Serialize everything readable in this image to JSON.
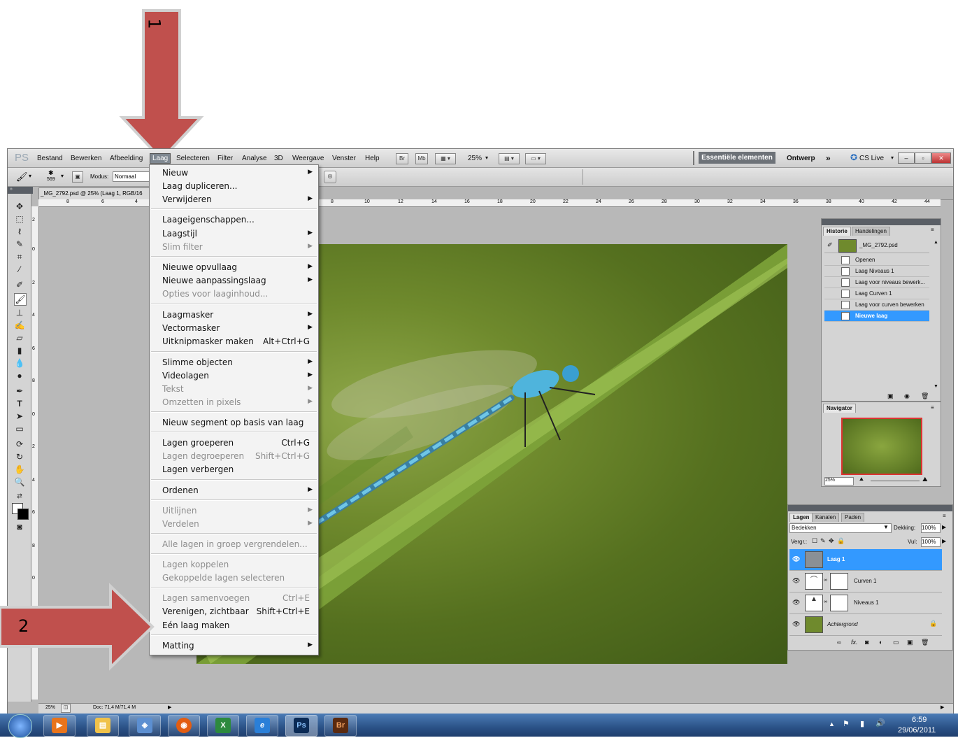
{
  "annotations": {
    "arrow1_label": "1",
    "arrow2_label": "2"
  },
  "colors": {
    "arrow_fill": "#c0504d",
    "arrow_border": "#cccccc",
    "menu_bg": "#f3f3f3",
    "selected_blue": "#3399ff"
  },
  "menubar": {
    "logo": "PS",
    "items": [
      "Bestand",
      "Bewerken",
      "Afbeelding",
      "Laag",
      "Selecteren",
      "Filter",
      "Analyse",
      "3D",
      "Weergave",
      "Venster",
      "Help"
    ],
    "br": "Br",
    "mb": "Mb",
    "zoom": "25%",
    "workspace_active": "Essentiële elementen",
    "workspace_other": "Ontwerp",
    "more": "»",
    "cslive": "CS Live"
  },
  "optionsbar": {
    "brush_size": "569",
    "mode_label": "Modus:",
    "mode_value": "Normaal"
  },
  "document": {
    "tab_title": "_MG_2792.psd @ 25% (Laag 1, RGB/16"
  },
  "ruler_top": [
    "8",
    "6",
    "4",
    "8",
    "10",
    "12",
    "14",
    "16",
    "18",
    "20",
    "22",
    "24",
    "26",
    "28",
    "30",
    "32",
    "34",
    "36",
    "38",
    "40",
    "42",
    "44"
  ],
  "ruler_left": [
    "2",
    "0",
    "2",
    "4",
    "6",
    "8",
    "0",
    "2",
    "4",
    "6",
    "8",
    "0",
    "2",
    "4"
  ],
  "statusbar": {
    "zoom": "25%",
    "doc": "Doc: 71,4 M/71,4 M"
  },
  "laag_menu": {
    "groups": [
      [
        {
          "label": "Nieuw",
          "submenu": true
        },
        {
          "label": "Laag dupliceren..."
        },
        {
          "label": "Verwijderen",
          "submenu": true
        }
      ],
      [
        {
          "label": "Laageigenschappen..."
        },
        {
          "label": "Laagstijl",
          "submenu": true
        },
        {
          "label": "Slim filter",
          "submenu": true,
          "disabled": true
        }
      ],
      [
        {
          "label": "Nieuwe opvullaag",
          "submenu": true
        },
        {
          "label": "Nieuwe aanpassingslaag",
          "submenu": true
        },
        {
          "label": "Opties voor laaginhoud...",
          "disabled": true
        }
      ],
      [
        {
          "label": "Laagmasker",
          "submenu": true
        },
        {
          "label": "Vectormasker",
          "submenu": true
        },
        {
          "label": "Uitknipmasker maken",
          "shortcut": "Alt+Ctrl+G"
        }
      ],
      [
        {
          "label": "Slimme objecten",
          "submenu": true
        },
        {
          "label": "Videolagen",
          "submenu": true
        },
        {
          "label": "Tekst",
          "submenu": true,
          "disabled": true
        },
        {
          "label": "Omzetten in pixels",
          "submenu": true,
          "disabled": true
        }
      ],
      [
        {
          "label": "Nieuw segment op basis van laag"
        }
      ],
      [
        {
          "label": "Lagen groeperen",
          "shortcut": "Ctrl+G"
        },
        {
          "label": "Lagen degroeperen",
          "shortcut": "Shift+Ctrl+G",
          "disabled": true
        },
        {
          "label": "Lagen verbergen"
        }
      ],
      [
        {
          "label": "Ordenen",
          "submenu": true
        }
      ],
      [
        {
          "label": "Uitlijnen",
          "submenu": true,
          "disabled": true
        },
        {
          "label": "Verdelen",
          "submenu": true,
          "disabled": true
        }
      ],
      [
        {
          "label": "Alle lagen in groep vergrendelen...",
          "disabled": true
        }
      ],
      [
        {
          "label": "Lagen koppelen",
          "disabled": true
        },
        {
          "label": "Gekoppelde lagen selecteren",
          "disabled": true
        }
      ],
      [
        {
          "label": "Lagen samenvoegen",
          "shortcut": "Ctrl+E",
          "disabled": true
        },
        {
          "label": "Verenigen, zichtbaar",
          "shortcut": "Shift+Ctrl+E"
        },
        {
          "label": "Eén laag maken"
        }
      ],
      [
        {
          "label": "Matting",
          "submenu": true
        }
      ]
    ]
  },
  "historie": {
    "tabs": [
      "Historie",
      "Handelingen"
    ],
    "snapshot": "_MG_2792.psd",
    "items": [
      "Openen",
      "Laag Niveaus 1",
      "Laag voor niveaus bewerk...",
      "Laag Curven 1",
      "Laag voor curven bewerken",
      "Nieuwe laag"
    ],
    "selected_index": 5
  },
  "navigator": {
    "tab": "Navigator",
    "zoom": "25%"
  },
  "lagen": {
    "tabs": [
      "Lagen",
      "Kanalen",
      "Paden"
    ],
    "blend_mode": "Bedekken",
    "opacity_label": "Dekking:",
    "opacity_value": "100%",
    "lock_label": "Vergr.:",
    "fill_label": "Vul:",
    "fill_value": "100%",
    "layers": [
      "Laag 1",
      "Curven 1",
      "Niveaus 1",
      "Achtergrond"
    ],
    "selected_index": 0,
    "footer_fx": "fx."
  },
  "taskbar": {
    "time": "6:59",
    "date": "29/06/2011",
    "apps": [
      "Ps",
      "Br"
    ]
  }
}
